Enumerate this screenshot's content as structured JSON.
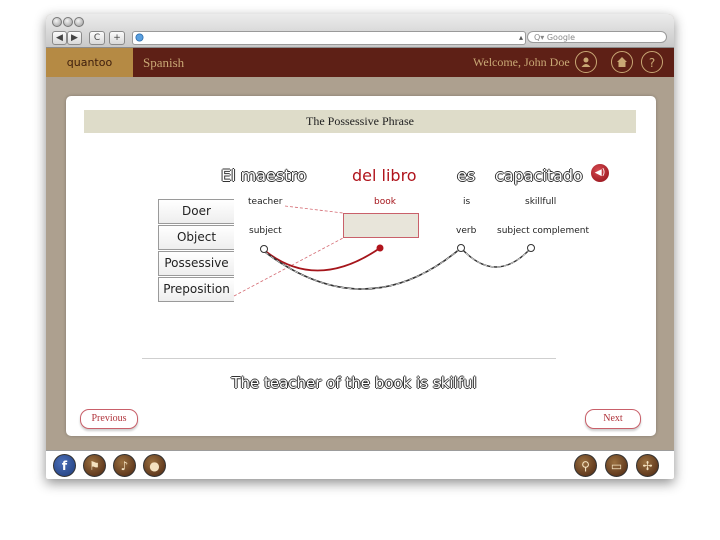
{
  "browser": {
    "nav": {
      "back": "◀",
      "forward": "▶",
      "reload": "C",
      "add": "+"
    },
    "search_placeholder": "Q▾ Google"
  },
  "app": {
    "logo": "quantoo",
    "course": "Spanish",
    "welcome": "Welcome, John Doe"
  },
  "lesson": {
    "title": "The Possessive Phrase",
    "words": [
      {
        "spanish": "El maestro",
        "english": "teacher",
        "role": "subject"
      },
      {
        "spanish": "del libro",
        "english": "book",
        "role": ""
      },
      {
        "spanish": "es",
        "english": "is",
        "role": "verb"
      },
      {
        "spanish": "capacitado",
        "english": "skillfull",
        "role": "subject complement"
      }
    ],
    "roles": [
      "Doer",
      "Object",
      "Possessive",
      "Preposition"
    ],
    "translation": "The teacher of the book is skilful",
    "previous_label": "Previous",
    "next_label": "Next"
  },
  "colors": {
    "brand_dark": "#5e2016",
    "brand_gold": "#b58a44",
    "accent_red": "#b0141c"
  }
}
